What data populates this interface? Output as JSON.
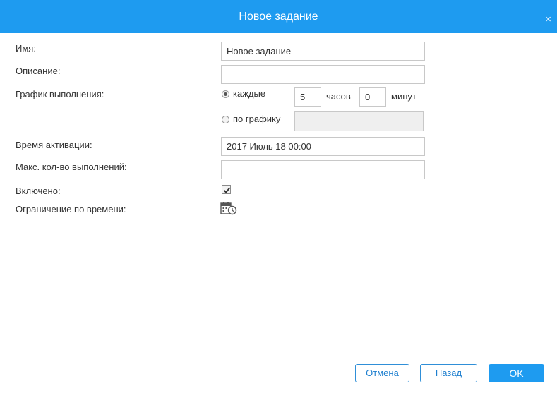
{
  "dialog": {
    "title": "Новое задание",
    "close_symbol": "×"
  },
  "form": {
    "name_label": "Имя:",
    "name_value": "Новое задание",
    "description_label": "Описание:",
    "description_value": "",
    "schedule_label": "График выполнения:",
    "every_label": "каждые",
    "hours_value": "5",
    "hours_label": "часов",
    "minutes_value": "0",
    "minutes_label": "минут",
    "by_schedule_label": "по графику",
    "by_schedule_value": "",
    "schedule_mode": "every",
    "activation_label": "Время активации:",
    "activation_value": "2017 Июль 18 00:00",
    "max_runs_label": "Макс. кол-во выполнений:",
    "max_runs_value": "",
    "enabled_label": "Включено:",
    "enabled": true,
    "time_limit_label": "Ограничение по времени:",
    "time_limit_icon": "calendar-clock-icon"
  },
  "buttons": {
    "cancel": "Отмена",
    "back": "Назад",
    "ok": "OK"
  },
  "colors": {
    "accent": "#1e9bf0",
    "button_border": "#2f8fd8"
  }
}
